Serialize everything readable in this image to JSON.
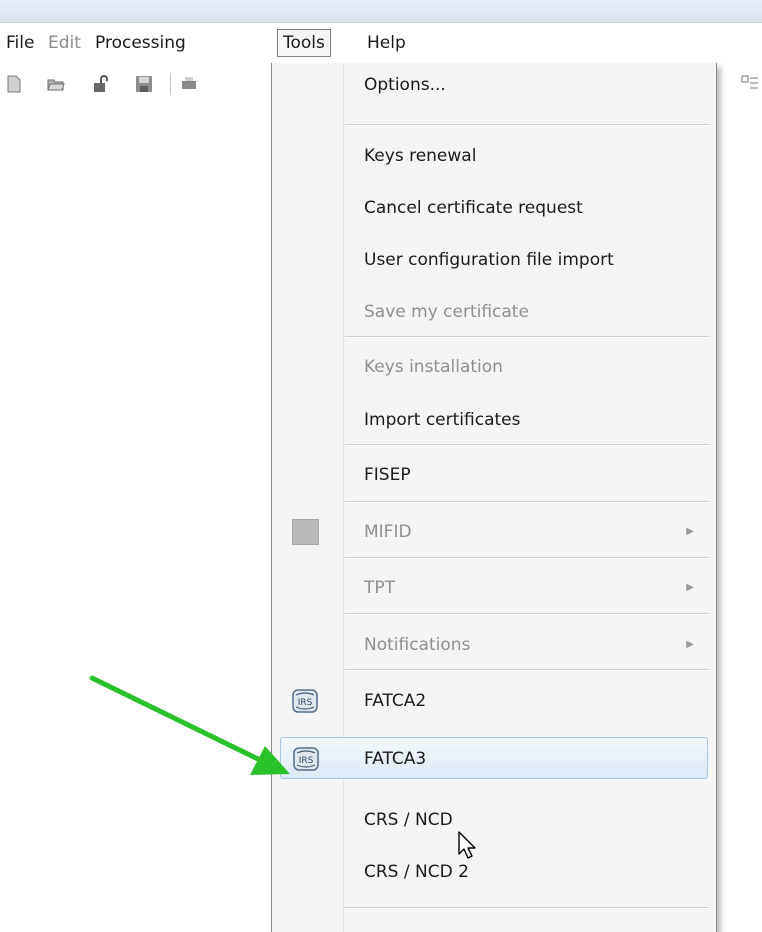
{
  "menubar": {
    "file": "File",
    "edit": "Edit",
    "processing": "Processing",
    "tools": "Tools",
    "help": "Help"
  },
  "tools_menu": {
    "options": "Options...",
    "keys_renewal": "Keys renewal",
    "cancel_cert_request": "Cancel certificate request",
    "user_config_import": "User configuration file import",
    "save_my_certificate": "Save my certificate",
    "keys_installation": "Keys installation",
    "import_certificates": "Import certificates",
    "fisep": "FISEP",
    "mifid": "MIFID",
    "tpt": "TPT",
    "notifications": "Notifications",
    "fatca2": "FATCA2",
    "fatca3": "FATCA3",
    "crs_ncd": "CRS / NCD",
    "crs_ncd2": "CRS / NCD 2"
  },
  "icons": {
    "toolbar": [
      "new-document-icon",
      "open-folder-icon",
      "unlock-icon",
      "save-icon",
      "print-icon"
    ],
    "irs": "irs-logo-icon",
    "cursor": "mouse-pointer-icon",
    "annotation": "green-arrow"
  },
  "colors": {
    "annotation_arrow": "#2bc12b",
    "hover_highlight": "#dde9f7",
    "disabled_text": "#8f8f8f"
  }
}
